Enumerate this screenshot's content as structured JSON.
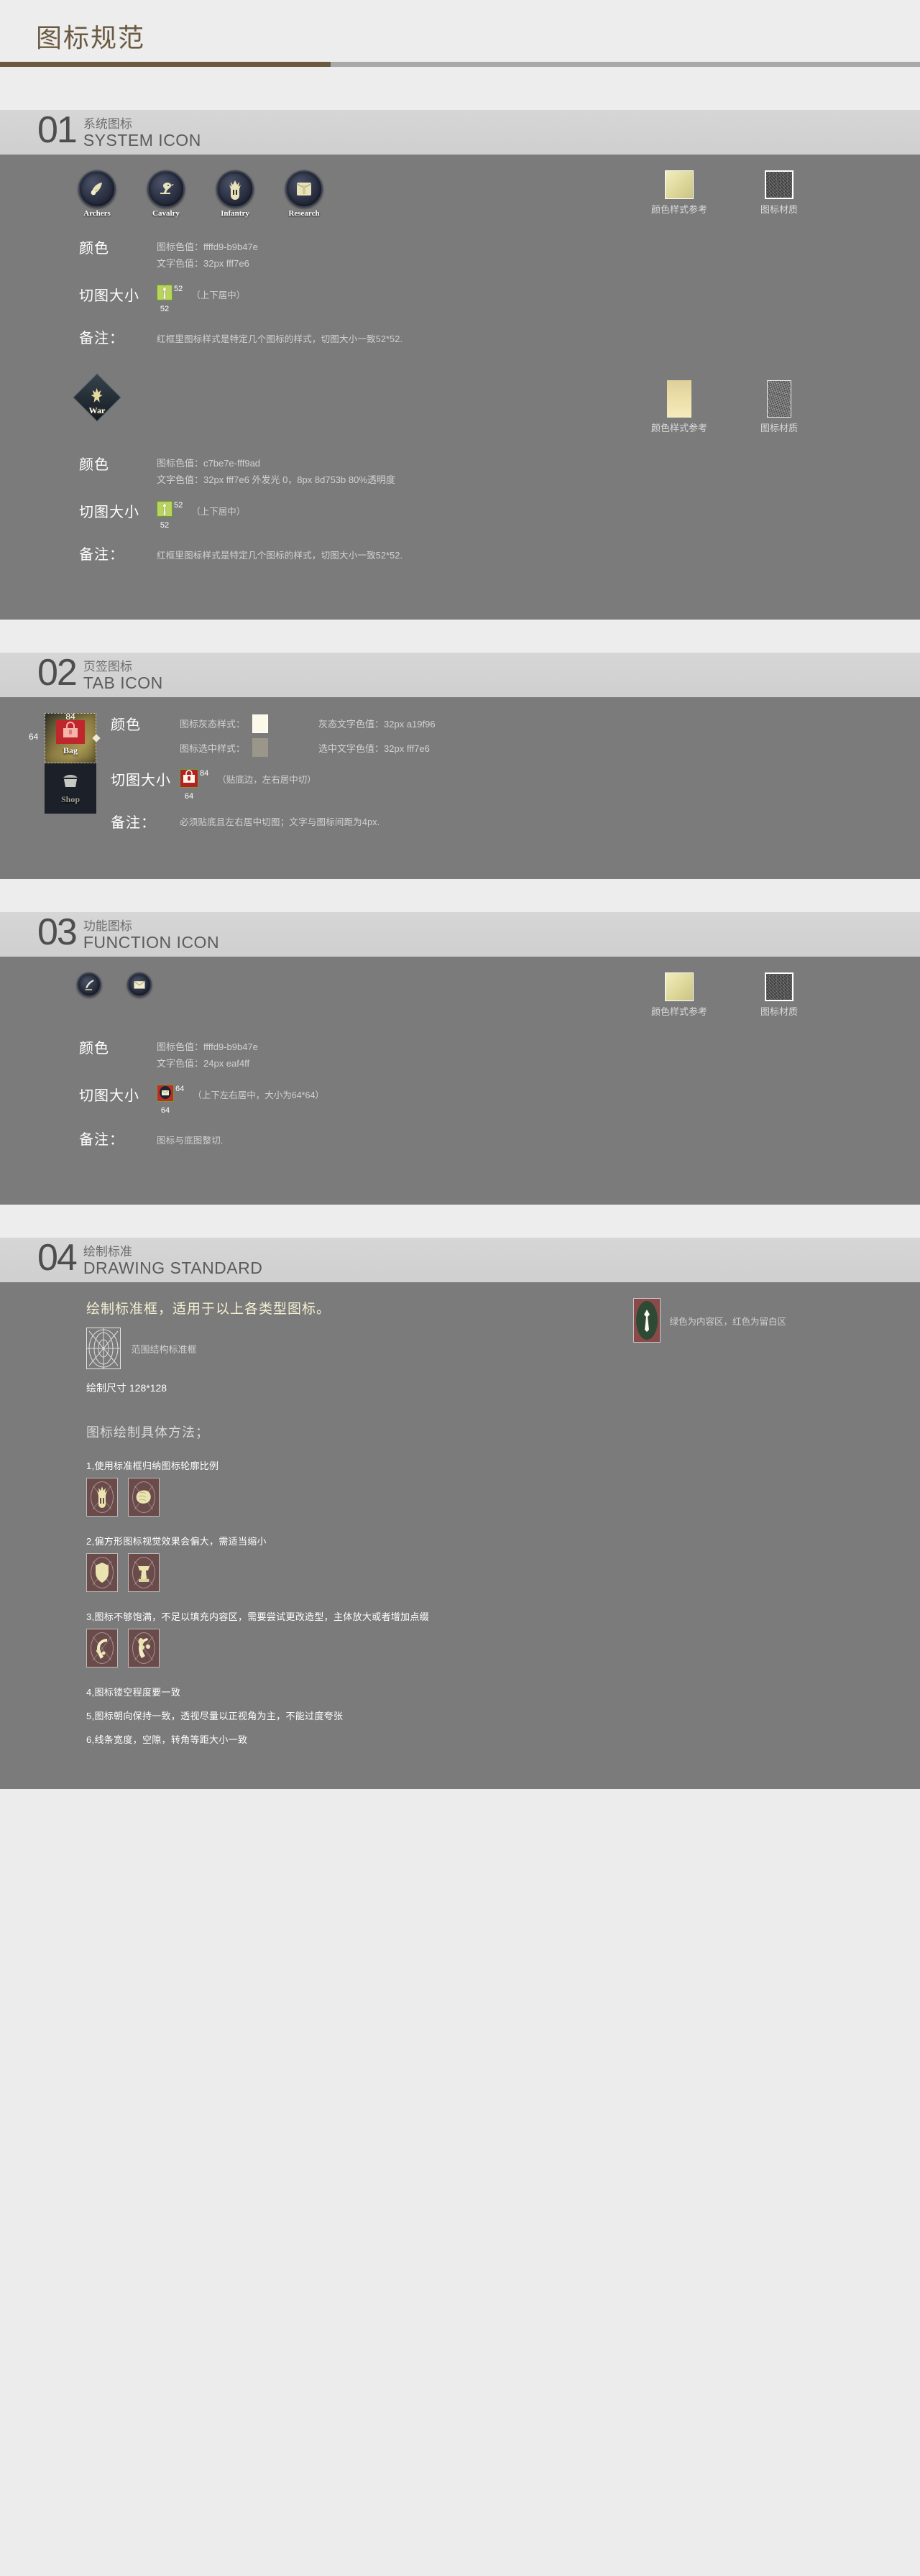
{
  "doc": {
    "title": "图标规范"
  },
  "sections": [
    {
      "num": "01",
      "cn": "系统图标",
      "en": "SYSTEM ICON",
      "blocks": [
        {
          "icons": [
            {
              "label": "Archers",
              "icon": "archers-horn-icon"
            },
            {
              "label": "Cavalry",
              "icon": "cavalry-bird-icon"
            },
            {
              "label": "Infantry",
              "icon": "infantry-helmet-icon"
            },
            {
              "label": "Research",
              "icon": "research-book-icon"
            }
          ],
          "swatches": [
            {
              "cap": "颜色样式参考",
              "kind": "color",
              "hex": "#ddd79a"
            },
            {
              "cap": "图标材质",
              "kind": "texture",
              "hex": "#4a4a4a"
            }
          ],
          "color_label": "颜色",
          "color_lines": [
            "图标色值：ffffd9-b9b47e",
            "文字色值：32px fff7e6"
          ],
          "crop_label": "切图大小",
          "crop_w": "52",
          "crop_h": "52",
          "crop_paren": "（上下居中）",
          "note_label": "备注：",
          "note_text": "红框里图标样式是特定几个图标的样式，切图大小一致52*52."
        },
        {
          "war_label": "War",
          "war_icon": "war-crest-icon",
          "swatches": [
            {
              "cap": "颜色样式参考",
              "kind": "color-tall",
              "hex": "#ecdfa8"
            },
            {
              "cap": "图标材质",
              "kind": "texture-tall",
              "hex": "#6d6d6d"
            }
          ],
          "color_label": "颜色",
          "color_lines": [
            "图标色值：c7be7e-fff9ad",
            "文字色值：32px fff7e6    外发光 0，8px 8d753b 80%透明度"
          ],
          "crop_label": "切图大小",
          "crop_w": "52",
          "crop_h": "52",
          "crop_paren": "（上下居中）",
          "note_label": "备注：",
          "note_text": "红框里图标样式是特定几个图标的样式，切图大小一致52*52."
        }
      ]
    },
    {
      "num": "02",
      "cn": "页签图标",
      "en": "TAB ICON",
      "tabs": [
        {
          "label": "Bag",
          "icon": "bag-icon",
          "state": "selected",
          "mark_top": "84",
          "mark_left": "64"
        },
        {
          "label": "Shop",
          "icon": "shop-icon",
          "state": "unselected"
        }
      ],
      "color_label": "颜色",
      "rows": [
        {
          "left": "图标灰态样式：",
          "swatch": "#fdf9e9",
          "right": "灰态文字色值：32px a19f96"
        },
        {
          "left": "图标选中样式：",
          "swatch": "#9a9689",
          "right": "选中文字色值：32px fff7e6"
        }
      ],
      "crop_label": "切图大小",
      "crop_w": "84",
      "crop_h": "64",
      "crop_paren": "（贴底边，左右居中切）",
      "note_label": "备注：",
      "note_text": "必须贴底且左右居中切图；文字与图标间距为4px."
    },
    {
      "num": "03",
      "cn": "功能图标",
      "en": "FUNCTION ICON",
      "icons": [
        {
          "icon": "quill-pen-icon"
        },
        {
          "icon": "mail-envelope-icon"
        }
      ],
      "swatches": [
        {
          "cap": "颜色样式参考",
          "kind": "color",
          "hex": "#ddd79a"
        },
        {
          "cap": "图标材质",
          "kind": "texture",
          "hex": "#4a4a4a"
        }
      ],
      "color_label": "颜色",
      "color_lines": [
        "图标色值：ffffd9-b9b47e",
        "文字色值：24px eaf4ff"
      ],
      "crop_label": "切图大小",
      "crop_w": "64",
      "crop_h": "64",
      "crop_paren": "（上下左右居中，大小为64*64）",
      "note_label": "备注：",
      "note_text": "图标与底图整切."
    },
    {
      "num": "04",
      "cn": "绘制标准",
      "en": "DRAWING STANDARD",
      "headline": "绘制标准框，适用于以上各类型图标。",
      "frame_caption": "范围结构标准框",
      "content_zone_caption": "绿色为内容区，红色为留白区",
      "draw_size": "绘制尺寸 128*128",
      "method_title": "图标绘制具体方法；",
      "rules": [
        {
          "text": "1,使用标准框归纳图标轮廓比例",
          "samples": [
            "helmet-sample-icon",
            "fist-sample-icon"
          ]
        },
        {
          "text": "2,偏方形图标视觉效果会偏大，需适当缩小",
          "samples": [
            "shield-sample-icon",
            "anvil-sample-icon"
          ]
        },
        {
          "text": "3,图标不够饱满，不足以填充内容区，需要尝试更改造型，主体放大或者增加点缀",
          "samples": [
            "horn-sample-icon",
            "horn-decorated-sample-icon"
          ]
        },
        {
          "text": "4,图标镂空程度要一致",
          "samples": []
        },
        {
          "text": "5,图标朝向保持一致，透视尽量以正视角为主，不能过度夸张",
          "samples": []
        },
        {
          "text": "6,线条宽度，空隙，转角等距大小一致",
          "samples": []
        }
      ]
    }
  ],
  "colors": {
    "accent_brown": "#6b5a40",
    "panel_dark": "#7b7b7b",
    "band": "#d6d6d6",
    "page_bg": "#ededed"
  }
}
